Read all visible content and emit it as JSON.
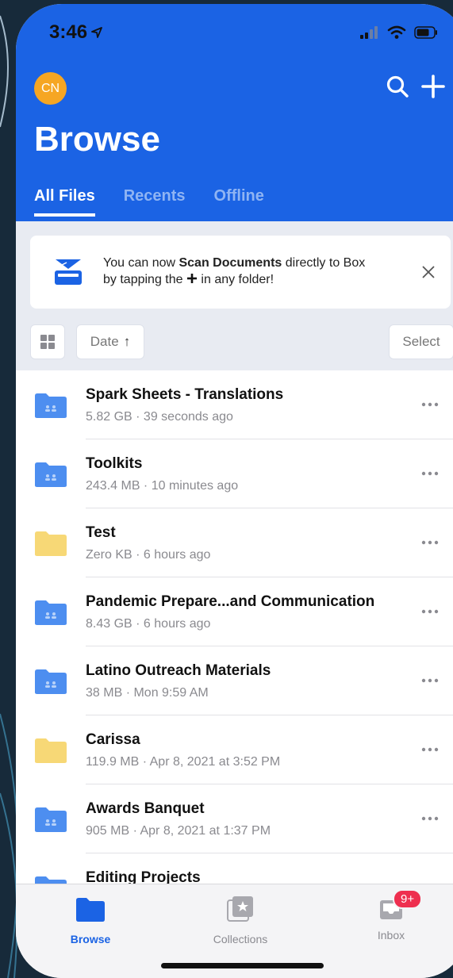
{
  "status": {
    "time": "3:46"
  },
  "header": {
    "avatar_initials": "CN",
    "title": "Browse",
    "tabs": [
      {
        "label": "All Files",
        "active": true
      },
      {
        "label": "Recents",
        "active": false
      },
      {
        "label": "Offline",
        "active": false
      }
    ]
  },
  "banner": {
    "text_prefix": "You can now ",
    "text_bold": "Scan Documents",
    "text_suffix": " directly to Box",
    "line2_prefix": "by tapping the ",
    "line2_suffix": " in any folder!"
  },
  "controls": {
    "sort_label": "Date",
    "sort_arrow": "↑",
    "select_label": "Select"
  },
  "files": [
    {
      "name": "Spark Sheets - Translations",
      "meta": "5.82 GB · 39 seconds ago",
      "type": "shared"
    },
    {
      "name": "Toolkits",
      "meta": "243.4 MB · 10 minutes ago",
      "type": "shared"
    },
    {
      "name": "Test",
      "meta": "Zero KB · 6 hours ago",
      "type": "personal"
    },
    {
      "name": "Pandemic Prepare...and Communication",
      "meta": "8.43 GB · 6 hours ago",
      "type": "shared"
    },
    {
      "name": "Latino Outreach Materials",
      "meta": "38 MB · Mon 9:59 AM",
      "type": "shared"
    },
    {
      "name": "Carissa",
      "meta": "119.9 MB · Apr 8, 2021 at 3:52 PM",
      "type": "personal"
    },
    {
      "name": "Awards Banquet",
      "meta": "905 MB · Apr 8, 2021 at 1:37 PM",
      "type": "shared"
    },
    {
      "name": "Editing Projects",
      "meta": "",
      "type": "shared"
    }
  ],
  "tabbar": {
    "items": [
      {
        "label": "Browse",
        "icon": "folder-icon",
        "active": true
      },
      {
        "label": "Collections",
        "icon": "collections-icon",
        "active": false
      },
      {
        "label": "Inbox",
        "icon": "inbox-icon",
        "active": false,
        "badge": "9+"
      }
    ]
  },
  "colors": {
    "brand_blue": "#1b63e4",
    "avatar_orange": "#f6a623",
    "shared_folder": "#4d8ef0",
    "personal_folder": "#f7d876",
    "badge_red": "#ee2f4f"
  }
}
